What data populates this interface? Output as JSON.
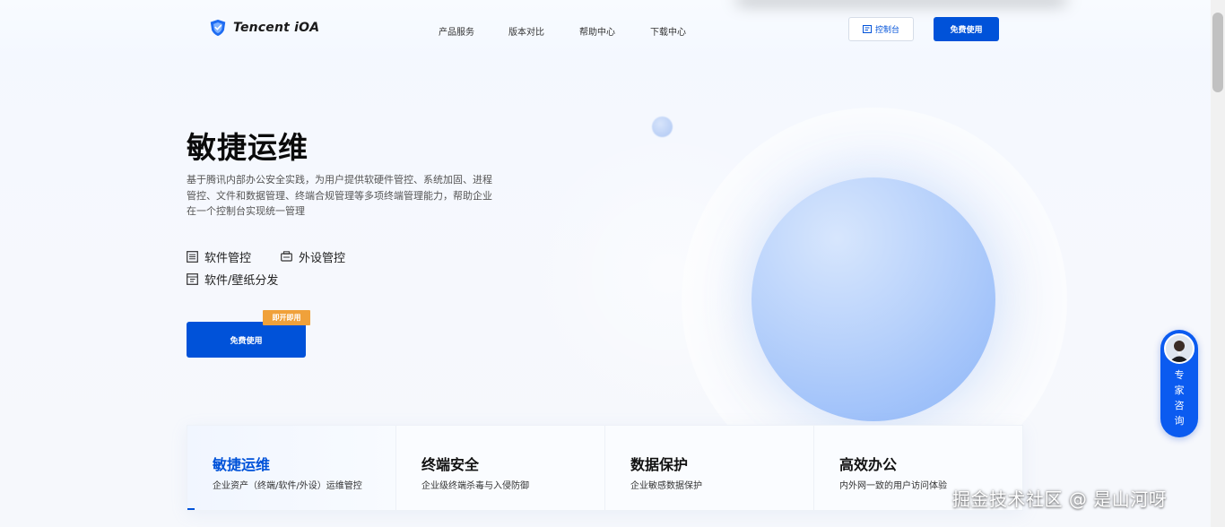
{
  "header": {
    "brand": "Tencent iOA",
    "nav": [
      "产品服务",
      "版本对比",
      "帮助中心",
      "下载中心"
    ],
    "console_label": "控制台",
    "free_label": "免费使用"
  },
  "hero": {
    "title": "敏捷运维",
    "description": "基于腾讯内部办公安全实践，为用户提供软硬件管控、系统加固、进程管控、文件和数据管理、终端合规管理等多项终端管理能力，帮助企业在一个控制台实现统一管理",
    "features": [
      "软件管控",
      "外设管控",
      "软件/壁纸分发"
    ],
    "cta_label": "免费使用",
    "cta_badge": "即开即用"
  },
  "consult": {
    "label": "专\n家\n咨\n询"
  },
  "tabs": [
    {
      "title": "敏捷运维",
      "subtitle": "企业资产（终端/软件/外设）运维管控"
    },
    {
      "title": "终端安全",
      "subtitle": "企业级终端杀毒与入侵防御"
    },
    {
      "title": "数据保护",
      "subtitle": "企业敏感数据保护"
    },
    {
      "title": "高效办公",
      "subtitle": "内外网一致的用户访问体验"
    }
  ],
  "watermark": "掘金技术社区 @ 是山河呀",
  "colors": {
    "primary": "#0052d9",
    "badge": "#f0a13a",
    "consult": "#0b5bf0"
  }
}
